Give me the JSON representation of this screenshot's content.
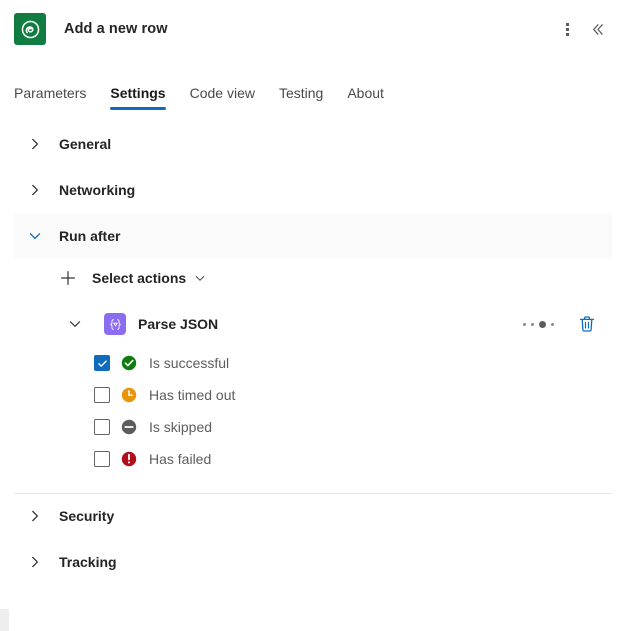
{
  "header": {
    "title": "Add a new row",
    "app_icon": "excel-online-icon",
    "icon_color": "#107c41",
    "more_menu_label": "more-options",
    "collapse_label": "collapse-panel"
  },
  "tabs": [
    {
      "label": "Parameters",
      "active": false
    },
    {
      "label": "Settings",
      "active": true
    },
    {
      "label": "Code view",
      "active": false
    },
    {
      "label": "Testing",
      "active": false
    },
    {
      "label": "About",
      "active": false
    }
  ],
  "accent_color": "#0f6cbd",
  "sections": {
    "general": {
      "label": "General",
      "expanded": false
    },
    "networking": {
      "label": "Networking",
      "expanded": false
    },
    "run_after": {
      "label": "Run after",
      "expanded": true
    },
    "security": {
      "label": "Security",
      "expanded": false
    },
    "tracking": {
      "label": "Tracking",
      "expanded": false
    }
  },
  "run_after": {
    "select_actions_label": "Select actions",
    "action": {
      "name": "Parse JSON",
      "icon": "parse-json-icon",
      "icon_color": "#8c6cf0",
      "expanded": true,
      "delete_label": "Delete action",
      "more_label": "More commands"
    },
    "statuses": [
      {
        "label": "Is successful",
        "checked": true,
        "icon": "success-check-icon",
        "color": "#107c10"
      },
      {
        "label": "Has timed out",
        "checked": false,
        "icon": "clock-icon",
        "color": "#e8940a"
      },
      {
        "label": "Is skipped",
        "checked": false,
        "icon": "skipped-dash-icon",
        "color": "#5c5c5c"
      },
      {
        "label": "Has failed",
        "checked": false,
        "icon": "error-icon",
        "color": "#b10e1c"
      }
    ]
  }
}
